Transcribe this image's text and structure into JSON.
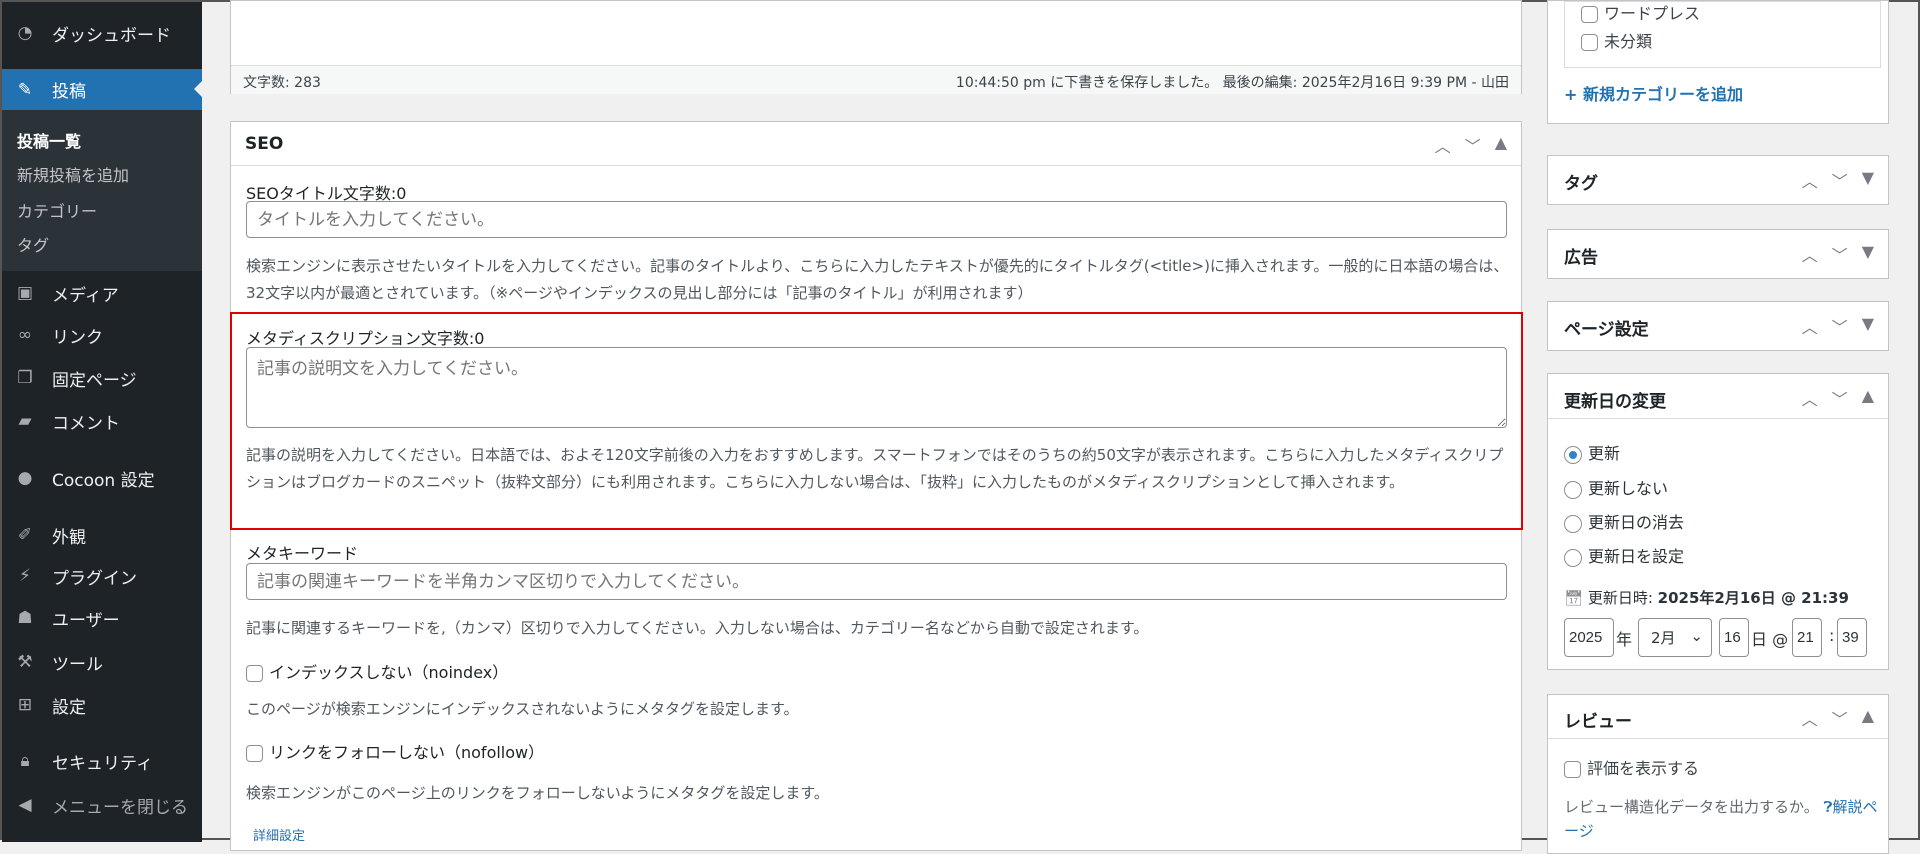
{
  "sidebar": {
    "items": [
      {
        "label": "ダッシュボード",
        "icon": "dashboard-icon"
      },
      {
        "label": "投稿",
        "icon": "pin-icon"
      },
      {
        "label": "メディア",
        "icon": "media-icon"
      },
      {
        "label": "リンク",
        "icon": "link-icon"
      },
      {
        "label": "固定ページ",
        "icon": "page-icon"
      },
      {
        "label": "コメント",
        "icon": "comment-icon"
      },
      {
        "label": "Cocoon 設定",
        "icon": "circle-icon"
      },
      {
        "label": "外観",
        "icon": "brush-icon"
      },
      {
        "label": "プラグイン",
        "icon": "plugin-icon"
      },
      {
        "label": "ユーザー",
        "icon": "user-icon"
      },
      {
        "label": "ツール",
        "icon": "wrench-icon"
      },
      {
        "label": "設定",
        "icon": "settings-icon"
      },
      {
        "label": "セキュリティ",
        "icon": "lock-icon"
      },
      {
        "label": "メニューを閉じる",
        "icon": "collapse-icon"
      }
    ],
    "submenu": [
      "投稿一覧",
      "新規投稿を追加",
      "カテゴリー",
      "タグ"
    ]
  },
  "editor": {
    "word_count": "文字数: 283",
    "status": "10:44:50 pm に下書きを保存しました。 最後の編集: 2025年2月16日 9:39 PM - 山田"
  },
  "seo": {
    "title": "SEO",
    "seo_title_label": "SEOタイトル文字数:0",
    "seo_title_placeholder": "タイトルを入力してください。",
    "seo_title_desc": "検索エンジンに表示させたいタイトルを入力してください。記事のタイトルより、こちらに入力したテキストが優先的にタイトルタグ(<title>)に挿入されます。一般的に日本語の場合は、32文字以内が最適とされています。（※ページやインデックスの見出し部分には「記事のタイトル」が利用されます）",
    "meta_desc_label": "メタディスクリプション文字数:0",
    "meta_desc_placeholder": "記事の説明文を入力してください。",
    "meta_desc_desc": "記事の説明を入力してください。日本語では、およそ120文字前後の入力をおすすめします。スマートフォンではそのうちの約50文字が表示されます。こちらに入力したメタディスクリプションはブログカードのスニペット（抜粋文部分）にも利用されます。こちらに入力しない場合は、「抜粋」に入力したものがメタディスクリプションとして挿入されます。",
    "keyword_label": "メタキーワード",
    "keyword_placeholder": "記事の関連キーワードを半角カンマ区切りで入力してください。",
    "keyword_desc": "記事に関連するキーワードを,（カンマ）区切りで入力してください。入力しない場合は、カテゴリー名などから自動で設定されます。",
    "noindex_label": "インデックスしない（noindex）",
    "noindex_desc": "このページが検索エンジンにインデックスされないようにメタタグを設定します。",
    "nofollow_label": "リンクをフォローしない（nofollow）",
    "nofollow_desc": "検索エンジンがこのページ上のリンクをフォローしないようにメタタグを設定します。",
    "advanced_link": "詳細設定"
  },
  "highlight_color": "#e00000",
  "right": {
    "categories": [
      "ワードプレス",
      "未分類"
    ],
    "add_category": "+ 新規カテゴリーを追加",
    "boxes": [
      "タグ",
      "広告",
      "ページ設定"
    ],
    "update": {
      "title": "更新日の変更",
      "options": [
        "更新",
        "更新しない",
        "更新日の消去",
        "更新日を設定"
      ],
      "selected": "更新",
      "datetime_label": "更新日時:",
      "datetime_value": "2025年2月16日 @ 21:39",
      "year": "2025",
      "year_suffix": "年",
      "month": "2月",
      "day": "16",
      "day_suffix": "日 @",
      "hour": "21",
      "colon": ":",
      "minute": "39"
    },
    "review": {
      "title": "レビュー",
      "show_rating": "評価を表示する",
      "desc": "レビュー構造化データを出力するか。",
      "help_link_a": "解",
      "help_link_b": "説ページ"
    }
  }
}
